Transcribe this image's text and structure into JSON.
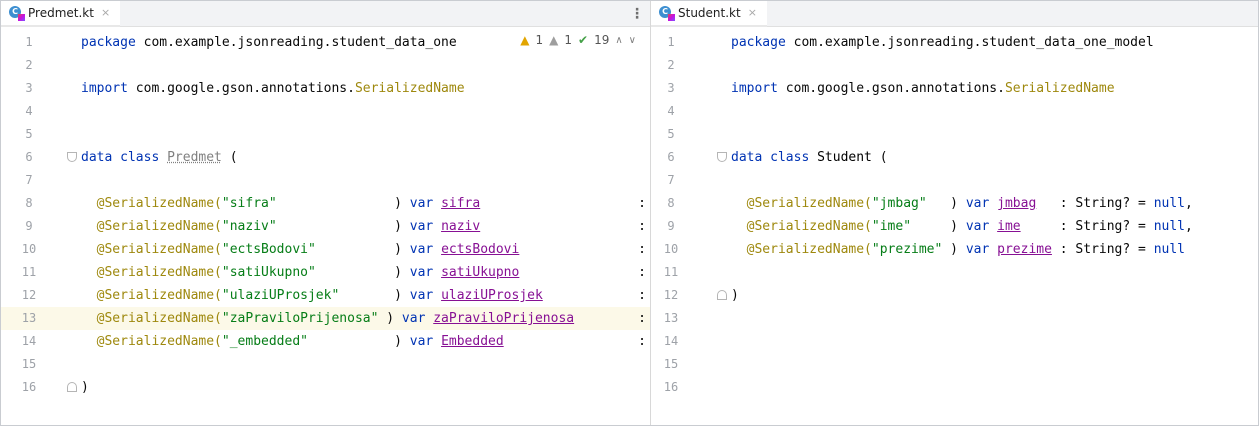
{
  "left": {
    "tab": {
      "label": "Predmet.kt",
      "close": "×",
      "icon": "kotlin-file-icon"
    },
    "menu": "⋮",
    "inspections": {
      "warnings": "1",
      "weak_warnings": "1",
      "typos": "19"
    },
    "lines": [
      {
        "n": "1",
        "segs": [
          [
            "kw",
            "package "
          ],
          [
            "",
            "com.example.jsonreading.student_data_one"
          ]
        ]
      },
      {
        "n": "2",
        "segs": []
      },
      {
        "n": "3",
        "segs": [
          [
            "kw",
            "import "
          ],
          [
            "",
            "com.google.gson.annotations."
          ],
          [
            "ann",
            "SerializedName"
          ]
        ]
      },
      {
        "n": "4",
        "segs": []
      },
      {
        "n": "5",
        "segs": []
      },
      {
        "n": "6",
        "segs": [
          [
            "kw",
            "data class "
          ],
          [
            "unused",
            "Predmet"
          ],
          [
            "",
            " ("
          ]
        ]
      },
      {
        "n": "7",
        "segs": []
      },
      {
        "n": "8",
        "segs": [
          [
            "",
            "  "
          ],
          [
            "ann",
            "@SerializedName("
          ],
          [
            "str",
            "\"sifra\""
          ],
          [
            "ann",
            "              "
          ],
          [
            "",
            " ) "
          ],
          [
            "kw",
            "var "
          ],
          [
            "prop",
            "sifra"
          ]
        ]
      },
      {
        "n": "9",
        "segs": [
          [
            "",
            "  "
          ],
          [
            "ann",
            "@SerializedName("
          ],
          [
            "str",
            "\"naziv\""
          ],
          [
            "ann",
            "              "
          ],
          [
            "",
            " ) "
          ],
          [
            "kw",
            "var "
          ],
          [
            "prop",
            "naziv"
          ]
        ]
      },
      {
        "n": "10",
        "segs": [
          [
            "",
            "  "
          ],
          [
            "ann",
            "@SerializedName("
          ],
          [
            "str",
            "\"ectsBodovi\""
          ],
          [
            "ann",
            "         "
          ],
          [
            "",
            " ) "
          ],
          [
            "kw",
            "var "
          ],
          [
            "prop",
            "ectsBodovi"
          ]
        ]
      },
      {
        "n": "11",
        "segs": [
          [
            "",
            "  "
          ],
          [
            "ann",
            "@SerializedName("
          ],
          [
            "str",
            "\"satiUkupno\""
          ],
          [
            "ann",
            "         "
          ],
          [
            "",
            " ) "
          ],
          [
            "kw",
            "var "
          ],
          [
            "prop",
            "satiUkupno"
          ]
        ]
      },
      {
        "n": "12",
        "segs": [
          [
            "",
            "  "
          ],
          [
            "ann",
            "@SerializedName("
          ],
          [
            "str",
            "\"ulaziUProsjek\""
          ],
          [
            "ann",
            "      "
          ],
          [
            "",
            " ) "
          ],
          [
            "kw",
            "var "
          ],
          [
            "prop",
            "ulaziUProsjek"
          ]
        ]
      },
      {
        "n": "13",
        "segs": [
          [
            "",
            "  "
          ],
          [
            "ann",
            "@SerializedName("
          ],
          [
            "str",
            "\"zaPraviloPrijenosa\""
          ],
          [
            "",
            " ) "
          ],
          [
            "kw",
            "var "
          ],
          [
            "prop",
            "zaPraviloPrijenosa"
          ]
        ]
      },
      {
        "n": "14",
        "segs": [
          [
            "",
            "  "
          ],
          [
            "ann",
            "@SerializedName("
          ],
          [
            "str",
            "\"_embedded\""
          ],
          [
            "ann",
            "          "
          ],
          [
            "",
            " ) "
          ],
          [
            "kw",
            "var "
          ],
          [
            "prop",
            "Embedded"
          ]
        ]
      },
      {
        "n": "15",
        "segs": []
      },
      {
        "n": "16",
        "segs": [
          [
            "",
            ")"
          ]
        ]
      }
    ],
    "colon": ":"
  },
  "right": {
    "tab": {
      "label": "Student.kt",
      "close": "×",
      "icon": "kotlin-file-icon"
    },
    "lines": [
      {
        "n": "1",
        "segs": [
          [
            "kw",
            "package "
          ],
          [
            "",
            "com.example.jsonreading.student_data_one_model"
          ]
        ]
      },
      {
        "n": "2",
        "segs": []
      },
      {
        "n": "3",
        "segs": [
          [
            "kw",
            "import "
          ],
          [
            "",
            "com.google.gson.annotations."
          ],
          [
            "ann",
            "SerializedName"
          ]
        ]
      },
      {
        "n": "4",
        "segs": []
      },
      {
        "n": "5",
        "segs": []
      },
      {
        "n": "6",
        "segs": [
          [
            "kw",
            "data class "
          ],
          [
            "cls",
            "Student"
          ],
          [
            "",
            " ("
          ]
        ]
      },
      {
        "n": "7",
        "segs": []
      },
      {
        "n": "8",
        "segs": [
          [
            "",
            "  "
          ],
          [
            "ann",
            "@SerializedName("
          ],
          [
            "str",
            "\"jmbag\""
          ],
          [
            "ann",
            "  "
          ],
          [
            "",
            " ) "
          ],
          [
            "kw",
            "var "
          ],
          [
            "prop",
            "jmbag"
          ],
          [
            "",
            "   : String? = "
          ],
          [
            "kw",
            "null"
          ],
          [
            "",
            ","
          ]
        ]
      },
      {
        "n": "9",
        "segs": [
          [
            "",
            "  "
          ],
          [
            "ann",
            "@SerializedName("
          ],
          [
            "str",
            "\"ime\""
          ],
          [
            "ann",
            "    "
          ],
          [
            "",
            " ) "
          ],
          [
            "kw",
            "var "
          ],
          [
            "prop",
            "ime"
          ],
          [
            "",
            "     : String? = "
          ],
          [
            "kw",
            "null"
          ],
          [
            "",
            ","
          ]
        ]
      },
      {
        "n": "10",
        "segs": [
          [
            "",
            "  "
          ],
          [
            "ann",
            "@SerializedName("
          ],
          [
            "str",
            "\"prezime\""
          ],
          [
            "",
            " ) "
          ],
          [
            "kw",
            "var "
          ],
          [
            "prop",
            "prezime"
          ],
          [
            "",
            " : String? = "
          ],
          [
            "kw",
            "null"
          ]
        ]
      },
      {
        "n": "11",
        "segs": []
      },
      {
        "n": "12",
        "segs": [
          [
            "",
            ")"
          ]
        ]
      },
      {
        "n": "13",
        "segs": []
      },
      {
        "n": "14",
        "segs": []
      },
      {
        "n": "15",
        "segs": []
      },
      {
        "n": "16",
        "segs": []
      }
    ]
  },
  "colors": {
    "keyword": "#0033b3",
    "annotation": "#9e880d",
    "string": "#067d17",
    "property": "#871094",
    "caret_line": "#fcf9e8"
  }
}
